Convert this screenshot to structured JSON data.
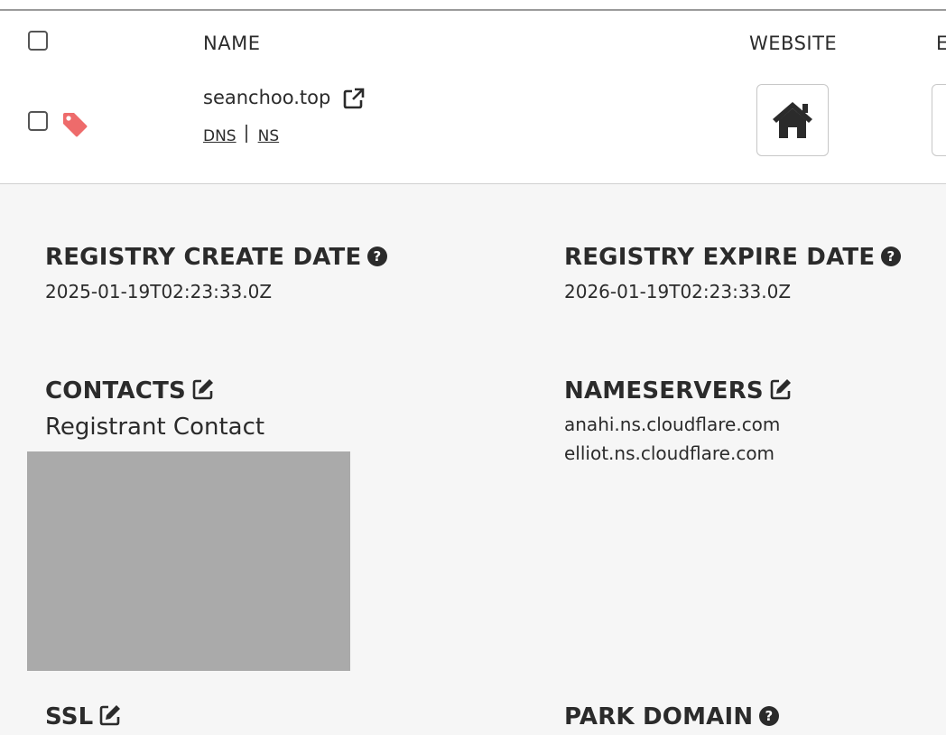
{
  "table": {
    "headers": {
      "name": "NAME",
      "website": "WEBSITE",
      "next": "E"
    }
  },
  "domain": {
    "name": "seanchoo.top",
    "links": [
      "DNS",
      "NS"
    ]
  },
  "details": {
    "registry_create_date": {
      "label": "REGISTRY CREATE DATE",
      "value": "2025-01-19T02:23:33.0Z"
    },
    "registry_expire_date": {
      "label": "REGISTRY EXPIRE DATE",
      "value": "2026-01-19T02:23:33.0Z"
    },
    "contacts": {
      "label": "CONTACTS",
      "registrant": "Registrant Contact"
    },
    "nameservers": {
      "label": "NAMESERVERS",
      "values": [
        "anahi.ns.cloudflare.com",
        "elliot.ns.cloudflare.com"
      ]
    },
    "ssl": {
      "label": "SSL"
    },
    "park_domain": {
      "label": "PARK DOMAIN"
    }
  },
  "colors": {
    "tag": "#ee6b6b",
    "panel_bg": "#f6f6f6",
    "redacted": "#aaaaaa"
  },
  "icons": [
    "tag-icon",
    "external-link-icon",
    "home-icon",
    "help-icon",
    "edit-icon"
  ]
}
